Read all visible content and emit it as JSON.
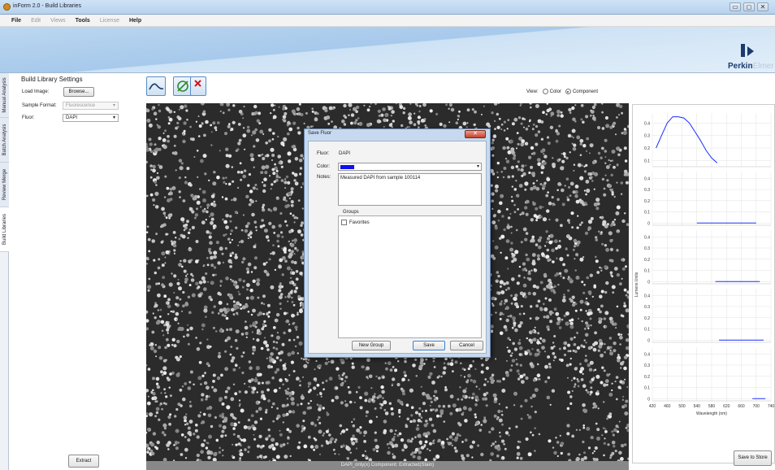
{
  "window": {
    "title": "inForm 2.0 - Build Libraries",
    "buttons": [
      "▭",
      "◻",
      "✕"
    ]
  },
  "menu": {
    "items": [
      {
        "label": "File",
        "enabled": true
      },
      {
        "label": "Edit",
        "enabled": false
      },
      {
        "label": "Views",
        "enabled": false
      },
      {
        "label": "Tools",
        "enabled": true
      },
      {
        "label": "License",
        "enabled": false
      },
      {
        "label": "Help",
        "enabled": true
      }
    ]
  },
  "logo": {
    "text_main": "Perkin",
    "text_faded": "Elmer"
  },
  "side_tabs": [
    "Manual Analysis",
    "Batch Analysis",
    "Review Merge",
    "Build Libraries"
  ],
  "left_panel": {
    "title": "Build Library Settings",
    "load_image_label": "Load Image:",
    "browse_label": "Browse...",
    "sample_format_label": "Sample Format:",
    "sample_format_value": "Fluorescence",
    "fluor_label": "Fluor:",
    "fluor_value": "DAPI",
    "extract_label": "Extract"
  },
  "view": {
    "label": "View:",
    "options": [
      {
        "label": "Color",
        "selected": false
      },
      {
        "label": "Component",
        "selected": true
      }
    ]
  },
  "image_status": "DAPI_only(x) Component: Extracted(Stain)",
  "dialog": {
    "title": "Save Fluor",
    "fluor_label": "Fluor:",
    "fluor_value": "DAPI",
    "color_label": "Color:",
    "color_value": "#1010ee",
    "notes_label": "Notes:",
    "notes_value": "Measured DAPI from sample 100114",
    "groups_label": "Groups",
    "groups": [
      {
        "label": "Favorites",
        "checked": false
      }
    ],
    "new_group_label": "New Group",
    "save_label": "Save",
    "cancel_label": "Cancel"
  },
  "right_panel": {
    "save_to_store_label": "Save to Store"
  },
  "chart_data": {
    "type": "line",
    "xlabel": "Wavelength (nm)",
    "ylabel": "Lumens Units",
    "x_ticks": [
      420,
      460,
      500,
      540,
      580,
      620,
      660,
      700,
      740
    ],
    "xlim": [
      420,
      740
    ],
    "panels": [
      {
        "y_ticks": [
          0.1,
          0.2,
          0.3,
          0.4
        ],
        "ylim": [
          0.05,
          0.48
        ],
        "series": {
          "x": [
            430,
            445,
            460,
            475,
            490,
            505,
            520,
            535,
            550,
            565,
            580,
            595
          ],
          "y": [
            0.2,
            0.3,
            0.4,
            0.45,
            0.45,
            0.44,
            0.4,
            0.33,
            0.26,
            0.18,
            0.12,
            0.08
          ]
        }
      },
      {
        "y_ticks": [
          0,
          0.1,
          0.2,
          0.3,
          0.4
        ],
        "ylim": [
          -0.02,
          0.46
        ],
        "series": {
          "x": [
            540,
            700
          ],
          "y": [
            0,
            0
          ]
        }
      },
      {
        "y_ticks": [
          0,
          0.1,
          0.2,
          0.3,
          0.4
        ],
        "ylim": [
          -0.02,
          0.46
        ],
        "series": {
          "x": [
            590,
            710
          ],
          "y": [
            0,
            0
          ]
        }
      },
      {
        "y_ticks": [
          0,
          0.1,
          0.2,
          0.3,
          0.4
        ],
        "ylim": [
          -0.02,
          0.46
        ],
        "series": {
          "x": [
            600,
            720
          ],
          "y": [
            0,
            0
          ]
        }
      },
      {
        "y_ticks": [
          0,
          0.1,
          0.2,
          0.3,
          0.4
        ],
        "ylim": [
          -0.02,
          0.46
        ],
        "series": {
          "x": [
            690,
            725
          ],
          "y": [
            0,
            0
          ]
        }
      }
    ],
    "color": "#1a2cff",
    "grid": true
  }
}
